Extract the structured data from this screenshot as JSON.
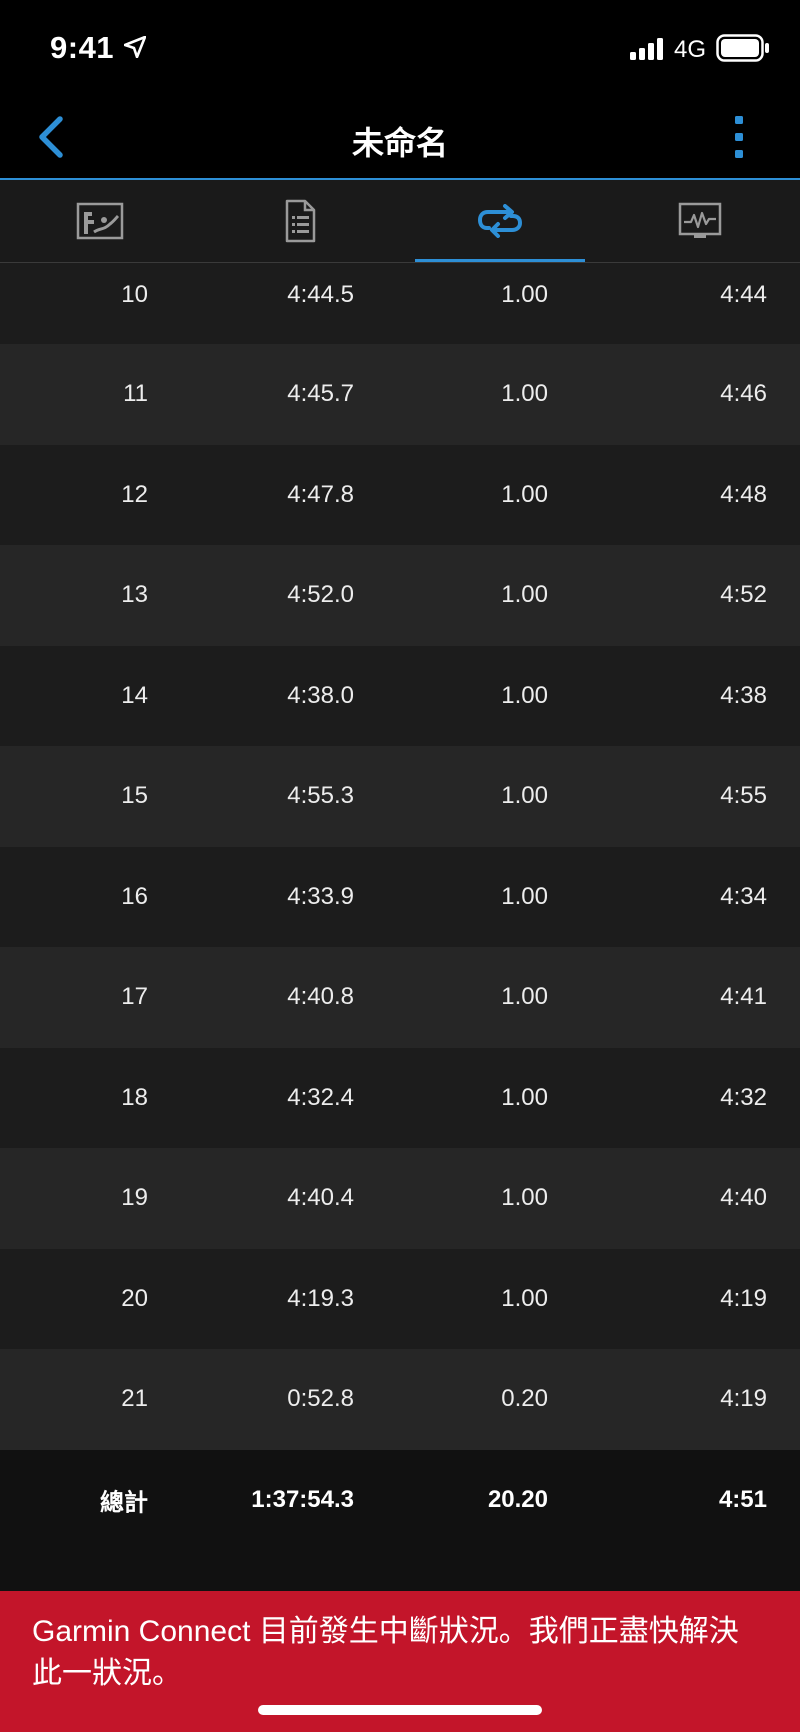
{
  "status_bar": {
    "time": "9:41",
    "network": "4G",
    "icons": [
      "location-arrow-icon",
      "signal-bars-icon",
      "battery-icon"
    ]
  },
  "nav": {
    "title": "未命名",
    "back_icon": "chevron-left-icon",
    "more_icon": "more-vertical-icon",
    "accent_color": "#2d8fd6"
  },
  "tabs": [
    {
      "icon": "map-overview-icon",
      "active": false
    },
    {
      "icon": "details-document-icon",
      "active": false
    },
    {
      "icon": "laps-loop-icon",
      "active": true
    },
    {
      "icon": "charts-monitor-icon",
      "active": false
    }
  ],
  "laps": [
    {
      "lap": "10",
      "time": "4:44.5",
      "distance": "1.00",
      "pace": "4:44"
    },
    {
      "lap": "11",
      "time": "4:45.7",
      "distance": "1.00",
      "pace": "4:46"
    },
    {
      "lap": "12",
      "time": "4:47.8",
      "distance": "1.00",
      "pace": "4:48"
    },
    {
      "lap": "13",
      "time": "4:52.0",
      "distance": "1.00",
      "pace": "4:52"
    },
    {
      "lap": "14",
      "time": "4:38.0",
      "distance": "1.00",
      "pace": "4:38"
    },
    {
      "lap": "15",
      "time": "4:55.3",
      "distance": "1.00",
      "pace": "4:55"
    },
    {
      "lap": "16",
      "time": "4:33.9",
      "distance": "1.00",
      "pace": "4:34"
    },
    {
      "lap": "17",
      "time": "4:40.8",
      "distance": "1.00",
      "pace": "4:41"
    },
    {
      "lap": "18",
      "time": "4:32.4",
      "distance": "1.00",
      "pace": "4:32"
    },
    {
      "lap": "19",
      "time": "4:40.4",
      "distance": "1.00",
      "pace": "4:40"
    },
    {
      "lap": "20",
      "time": "4:19.3",
      "distance": "1.00",
      "pace": "4:19"
    },
    {
      "lap": "21",
      "time": "0:52.8",
      "distance": "0.20",
      "pace": "4:19"
    }
  ],
  "total": {
    "label": "總計",
    "time": "1:37:54.3",
    "distance": "20.20",
    "pace": "4:51"
  },
  "error_banner": {
    "message": "Garmin Connect 目前發生中斷狀況。我們正盡快解決此一狀況。",
    "color": "#c3152a"
  }
}
